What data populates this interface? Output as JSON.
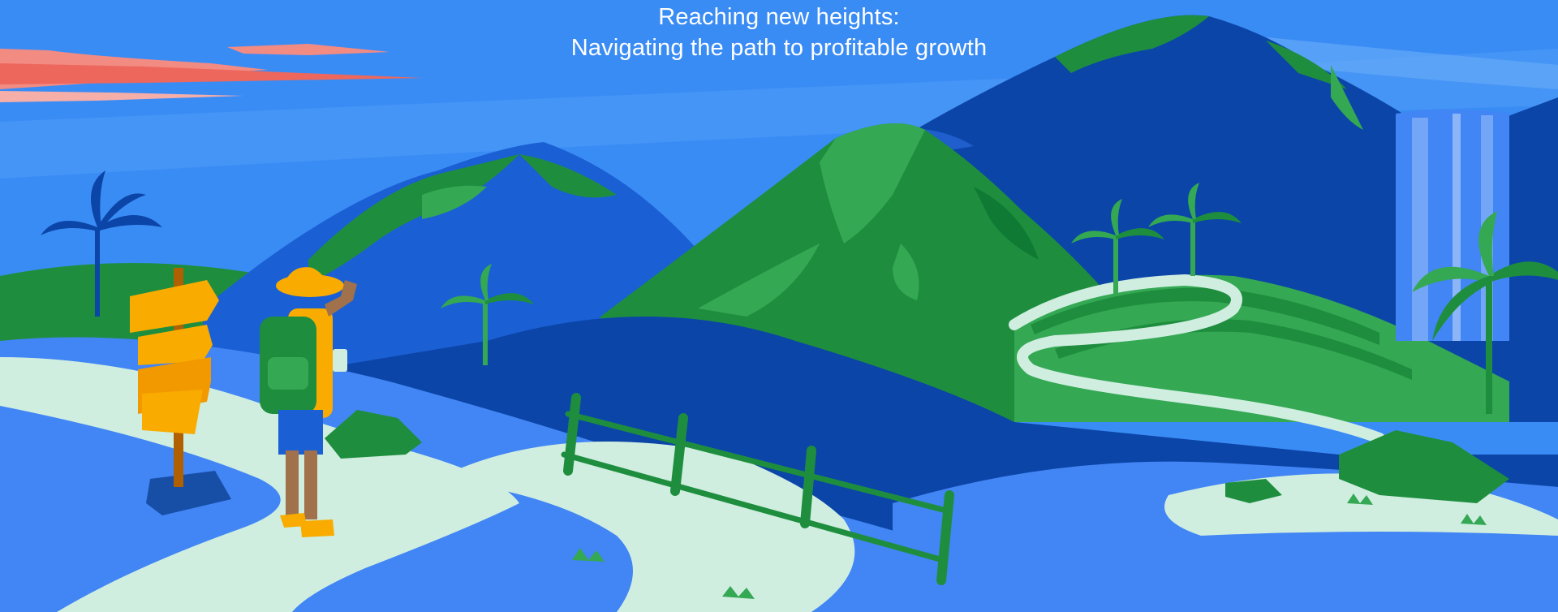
{
  "hero": {
    "headline_line1": "Reaching new heights:",
    "headline_line2": "Navigating the path to profitable growth"
  },
  "palette": {
    "sky": "#3a8cf5",
    "deep_blue": "#0b45a8",
    "mid_blue": "#1a5fd4",
    "green": "#1e8e3e",
    "light_green": "#34a853",
    "path": "#cfeee0",
    "sign_orange": "#f9ab00",
    "cloud_pink": "#f28b82"
  },
  "illustration": {
    "icons": [
      "hiker-icon",
      "signpost-icon",
      "palm-tree-icon",
      "waterfall-icon",
      "fence-icon",
      "mountain-icon",
      "cloud-icon"
    ]
  }
}
